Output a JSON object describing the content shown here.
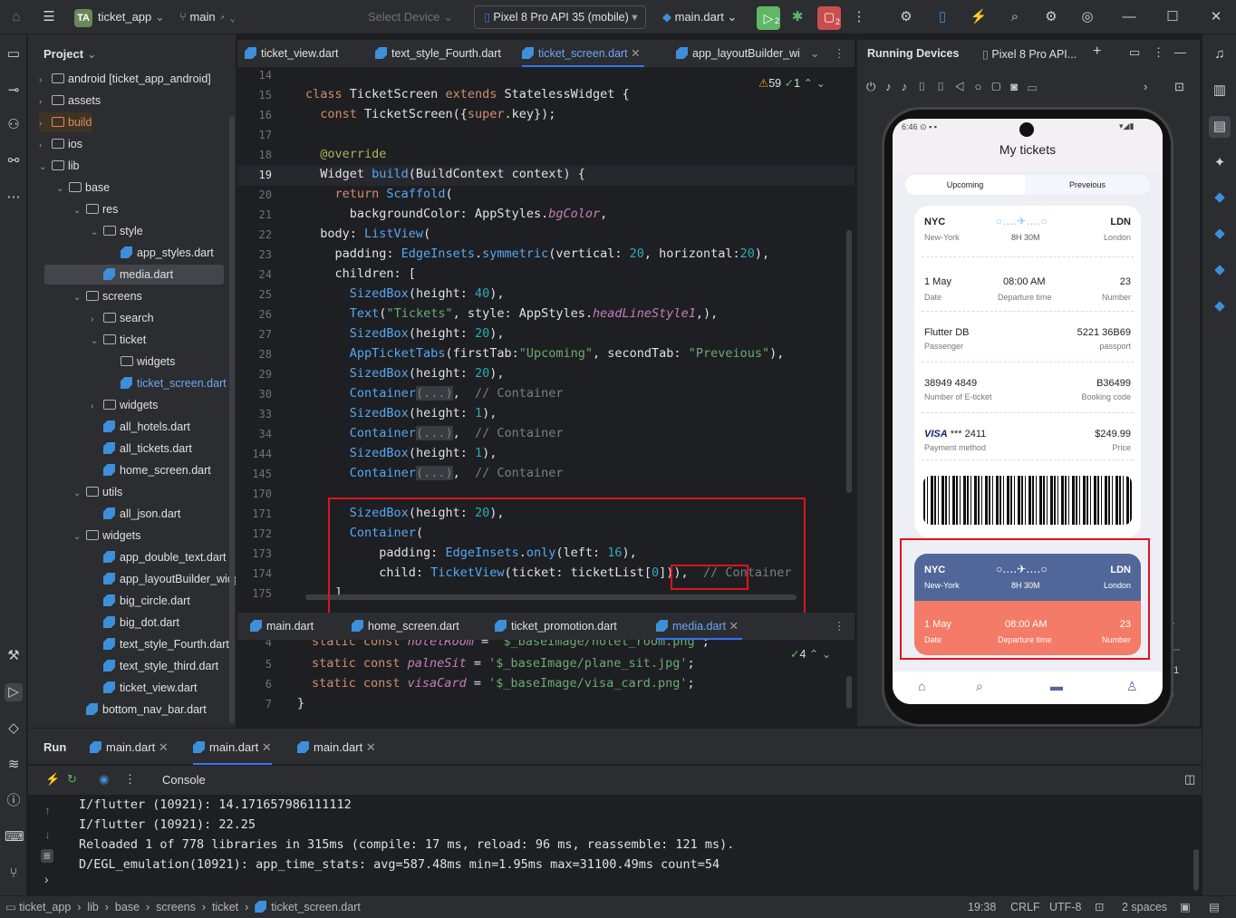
{
  "titlebar": {
    "project_badge": "TA",
    "project": "ticket_app",
    "branch": "main",
    "select_device": "Select Device",
    "device": "Pixel 8 Pro API 35 (mobile)",
    "run_config": "main.dart",
    "run_badge": "2",
    "stop_badge": "2"
  },
  "project_panel": {
    "title": "Project",
    "tree": [
      {
        "label": "android [ticket_app_android]",
        "indent": 0,
        "type": "folder",
        "arrow": "›"
      },
      {
        "label": "assets",
        "indent": 0,
        "type": "folder",
        "arrow": "›"
      },
      {
        "label": "build",
        "indent": 0,
        "type": "folder-build",
        "arrow": "›"
      },
      {
        "label": "ios",
        "indent": 0,
        "type": "folder",
        "arrow": "›"
      },
      {
        "label": "lib",
        "indent": 0,
        "type": "folder",
        "arrow": "⌄"
      },
      {
        "label": "base",
        "indent": 1,
        "type": "folder",
        "arrow": "⌄"
      },
      {
        "label": "res",
        "indent": 2,
        "type": "folder",
        "arrow": "⌄"
      },
      {
        "label": "style",
        "indent": 3,
        "type": "folder",
        "arrow": "⌄"
      },
      {
        "label": "app_styles.dart",
        "indent": 4,
        "type": "dart",
        "arrow": ""
      },
      {
        "label": "media.dart",
        "indent": 3,
        "type": "dart",
        "arrow": "",
        "selected": true
      },
      {
        "label": "screens",
        "indent": 2,
        "type": "folder",
        "arrow": "⌄"
      },
      {
        "label": "search",
        "indent": 3,
        "type": "folder",
        "arrow": "›"
      },
      {
        "label": "ticket",
        "indent": 3,
        "type": "folder",
        "arrow": "⌄"
      },
      {
        "label": "widgets",
        "indent": 4,
        "type": "folder",
        "arrow": ""
      },
      {
        "label": "ticket_screen.dart",
        "indent": 4,
        "type": "dart",
        "arrow": "",
        "active": true
      },
      {
        "label": "widgets",
        "indent": 3,
        "type": "folder",
        "arrow": "›"
      },
      {
        "label": "all_hotels.dart",
        "indent": 3,
        "type": "dart",
        "arrow": ""
      },
      {
        "label": "all_tickets.dart",
        "indent": 3,
        "type": "dart",
        "arrow": ""
      },
      {
        "label": "home_screen.dart",
        "indent": 3,
        "type": "dart",
        "arrow": ""
      },
      {
        "label": "utils",
        "indent": 2,
        "type": "folder",
        "arrow": "⌄"
      },
      {
        "label": "all_json.dart",
        "indent": 3,
        "type": "dart",
        "arrow": ""
      },
      {
        "label": "widgets",
        "indent": 2,
        "type": "folder",
        "arrow": "⌄"
      },
      {
        "label": "app_double_text.dart",
        "indent": 3,
        "type": "dart",
        "arrow": ""
      },
      {
        "label": "app_layoutBuilder_widg",
        "indent": 3,
        "type": "dart",
        "arrow": ""
      },
      {
        "label": "big_circle.dart",
        "indent": 3,
        "type": "dart",
        "arrow": ""
      },
      {
        "label": "big_dot.dart",
        "indent": 3,
        "type": "dart",
        "arrow": ""
      },
      {
        "label": "text_style_Fourth.dart",
        "indent": 3,
        "type": "dart",
        "arrow": ""
      },
      {
        "label": "text_style_third.dart",
        "indent": 3,
        "type": "dart",
        "arrow": ""
      },
      {
        "label": "ticket_view.dart",
        "indent": 3,
        "type": "dart",
        "arrow": ""
      },
      {
        "label": "bottom_nav_bar.dart",
        "indent": 2,
        "type": "dart",
        "arrow": ""
      }
    ]
  },
  "editor_tabs": [
    "ticket_view.dart",
    "text_style_Fourth.dart",
    "ticket_screen.dart",
    "app_layoutBuilder_wi"
  ],
  "inspection": {
    "warnings": "59",
    "checks": "1"
  },
  "editor_tabs2": [
    "main.dart",
    "home_screen.dart",
    "ticket_promotion.dart",
    "media.dart"
  ],
  "inspection2": {
    "checks": "4"
  },
  "running_devices": {
    "title": "Running Devices",
    "device_tab": "Pixel 8 Pro API...",
    "zoom": "1:1"
  },
  "phone": {
    "time": "6:46",
    "title": "My tickets",
    "tab1": "Upcoming",
    "tab2": "Preveious",
    "ticket": {
      "from_code": "NYC",
      "from_name": "New-York",
      "duration": "8H 30M",
      "to_code": "LDN",
      "to_name": "London",
      "date": "1 May",
      "date_label": "Date",
      "time": "08:00 AM",
      "time_label": "Departure time",
      "number": "23",
      "number_label": "Number",
      "passenger": "Flutter DB",
      "passenger_label": "Passenger",
      "passport": "5221 36B69",
      "passport_label": "passport",
      "eticket": "38949 4849",
      "eticket_label": "Number of E-ticket",
      "booking": "B36499",
      "booking_label": "Booking code",
      "visa": "VISA",
      "card": "*** 2411",
      "payment_label": "Payment method",
      "price": "$249.99",
      "price_label": "Price"
    },
    "ticket2": {
      "from_code": "NYC",
      "from_name": "New-York",
      "duration": "8H 30M",
      "to_code": "LDN",
      "to_name": "London",
      "date": "1 May",
      "date_label": "Date",
      "time": "08:00 AM",
      "time_label": "Departure time",
      "number": "23",
      "number_label": "Number"
    }
  },
  "run": {
    "label": "Run",
    "tabs": [
      "main.dart",
      "main.dart",
      "main.dart"
    ],
    "console": "Console",
    "lines": [
      "I/flutter (10921): 14.171657986111112",
      "I/flutter (10921): 22.25",
      "Reloaded 1 of 778 libraries in 315ms (compile: 17 ms, reload: 96 ms, reassemble: 121 ms).",
      "D/EGL_emulation(10921): app_time_stats: avg=587.48ms min=1.95ms max=31100.49ms count=54"
    ]
  },
  "status": {
    "crumbs": [
      "ticket_app",
      "lib",
      "base",
      "screens",
      "ticket",
      "ticket_screen.dart"
    ],
    "position": "19:38",
    "line_sep": "CRLF",
    "encoding": "UTF-8",
    "indent": "2 spaces"
  },
  "colors": {
    "accent": "#3574f0",
    "ticket_blue": "#526799",
    "ticket_orange": "#f37b67",
    "highlight": "#e0141e"
  }
}
